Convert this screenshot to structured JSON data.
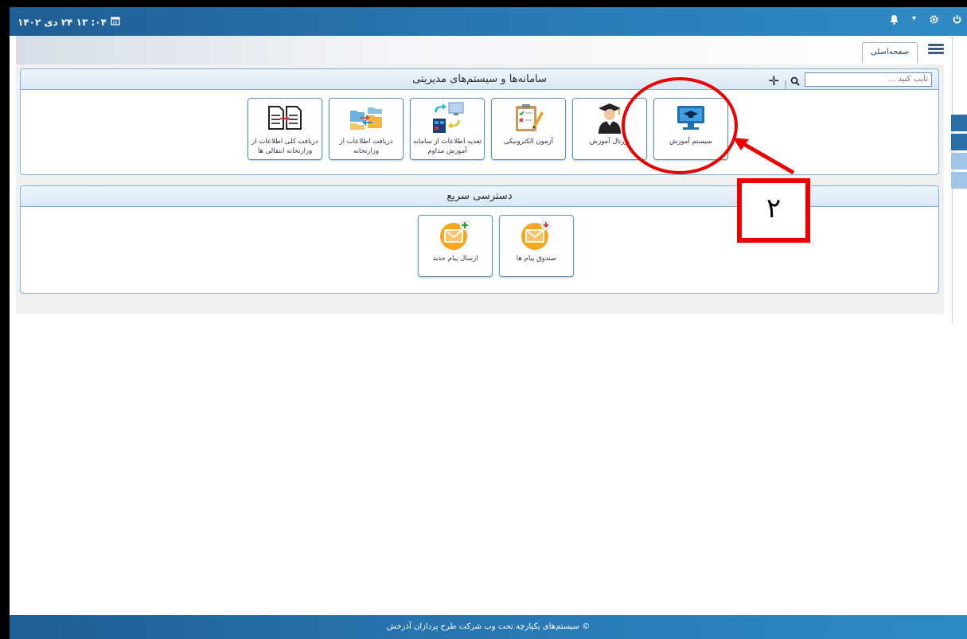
{
  "topbar": {
    "datetime": "۰۴: ۱۳ ۲۴ دی ۱۴۰۲",
    "icons": [
      "power-icon",
      "gear-icon",
      "bell-icon"
    ]
  },
  "tabs": {
    "home_label": "صفحه‌اصلی"
  },
  "systems_panel": {
    "title": "سامانه‌ها و سیستم‌های مدیریتی",
    "search_placeholder": "تایپ کنید ...",
    "tiles": [
      {
        "label": "سیستم آموزش",
        "icon": "graduation-monitor-icon"
      },
      {
        "label": "پورتال آموزش",
        "icon": "student-avatar-icon"
      },
      {
        "label": "آزمون الکترونیکی",
        "icon": "exam-checklist-icon"
      },
      {
        "label": "تغذیه اطلاعات از سامانه آموزش مداوم",
        "icon": "data-sync-icon"
      },
      {
        "label": "دریافت اطلاعات از وزارتخانه",
        "icon": "folder-transfer-icon"
      },
      {
        "label": "دریافت کلی اطلاعات از وزارتخانه انتقالی ها",
        "icon": "document-transfer-icon"
      }
    ]
  },
  "quick_panel": {
    "title": "دسترسی سریع",
    "tiles": [
      {
        "label": "صندوق پیام ها",
        "icon": "inbox-mail-icon"
      },
      {
        "label": "ارسال پیام جدید",
        "icon": "new-mail-icon"
      }
    ]
  },
  "annotation": {
    "number": "۲"
  },
  "footer": {
    "text": "© سیستم‌های یکپارچه تحت وب شرکت طرح پردازان آذرخش"
  },
  "colors": {
    "topbar": "#2a7ab5",
    "tile_border": "#5a97c2",
    "annotation": "#ee0000"
  }
}
